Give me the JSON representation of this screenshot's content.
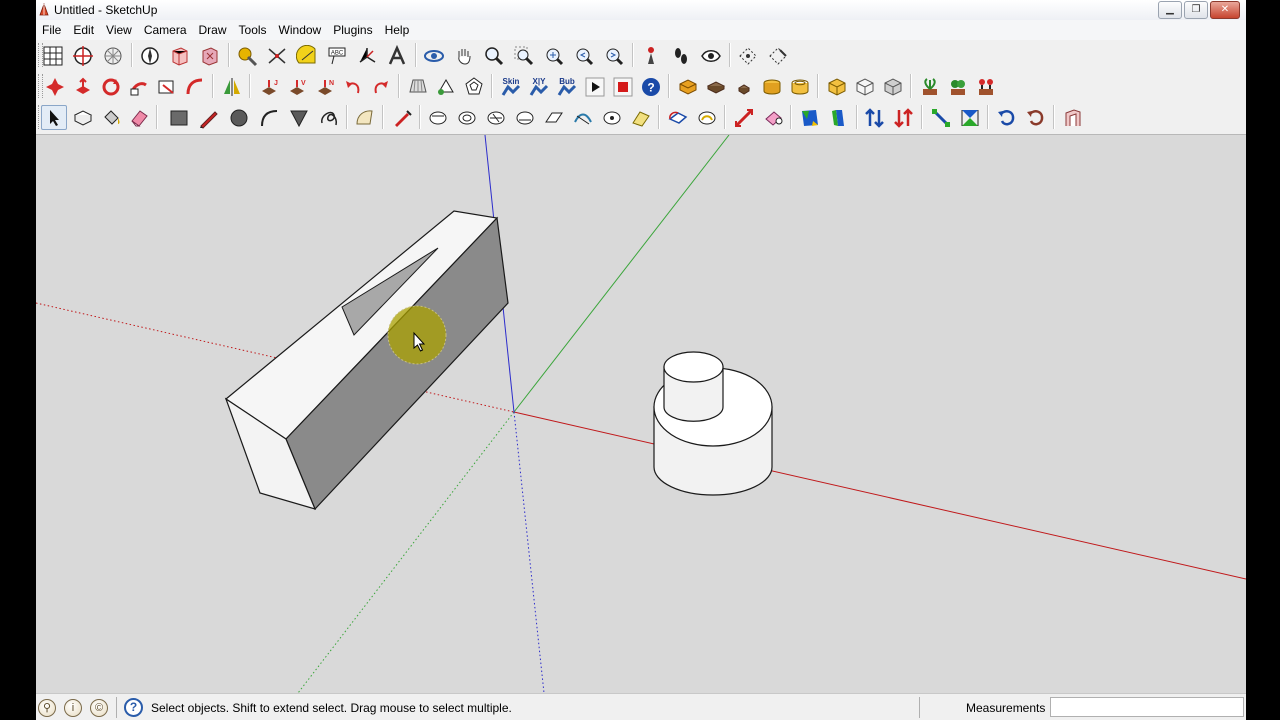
{
  "window": {
    "title": "Untitled - SketchUp"
  },
  "menu": [
    "File",
    "Edit",
    "View",
    "Camera",
    "Draw",
    "Tools",
    "Window",
    "Plugins",
    "Help"
  ],
  "toolbar_labels": {
    "skin": "Skin",
    "xyz": "X|Y",
    "bub": "Bub"
  },
  "status": {
    "hint": "Select objects. Shift to extend select. Drag mouse to select multiple.",
    "measurements_label": "Measurements",
    "measurements_value": ""
  },
  "colors": {
    "viewport_bg": "#d9d9d9",
    "red_axis": "#c0191b",
    "green_axis": "#3aa53a",
    "blue_axis": "#2c2ccc",
    "cursor_highlight": "#a9a000"
  }
}
